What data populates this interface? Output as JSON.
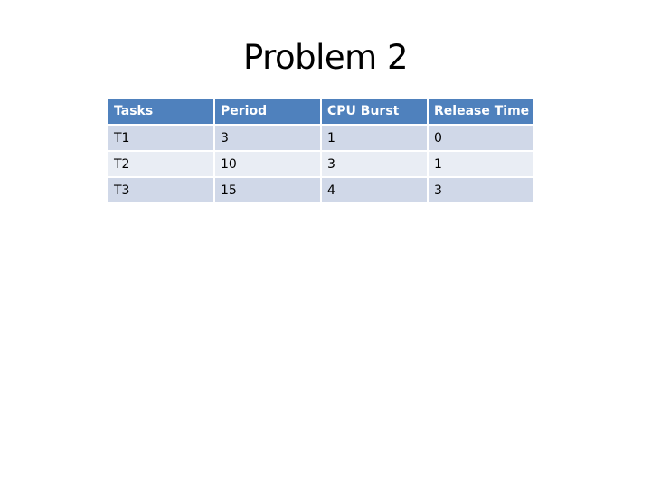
{
  "slide": {
    "title": "Problem 2",
    "table": {
      "headers": [
        "Tasks",
        "Period",
        "CPU Burst",
        "Release Time"
      ],
      "rows": [
        [
          "T1",
          "3",
          "1",
          "0"
        ],
        [
          "T2",
          "10",
          "3",
          "1"
        ],
        [
          "T3",
          "15",
          "4",
          "3"
        ]
      ]
    },
    "colors": {
      "header_bg": "#4f81bd",
      "row_band_1": "#d0d8e8",
      "row_band_2": "#e9edf4"
    }
  }
}
